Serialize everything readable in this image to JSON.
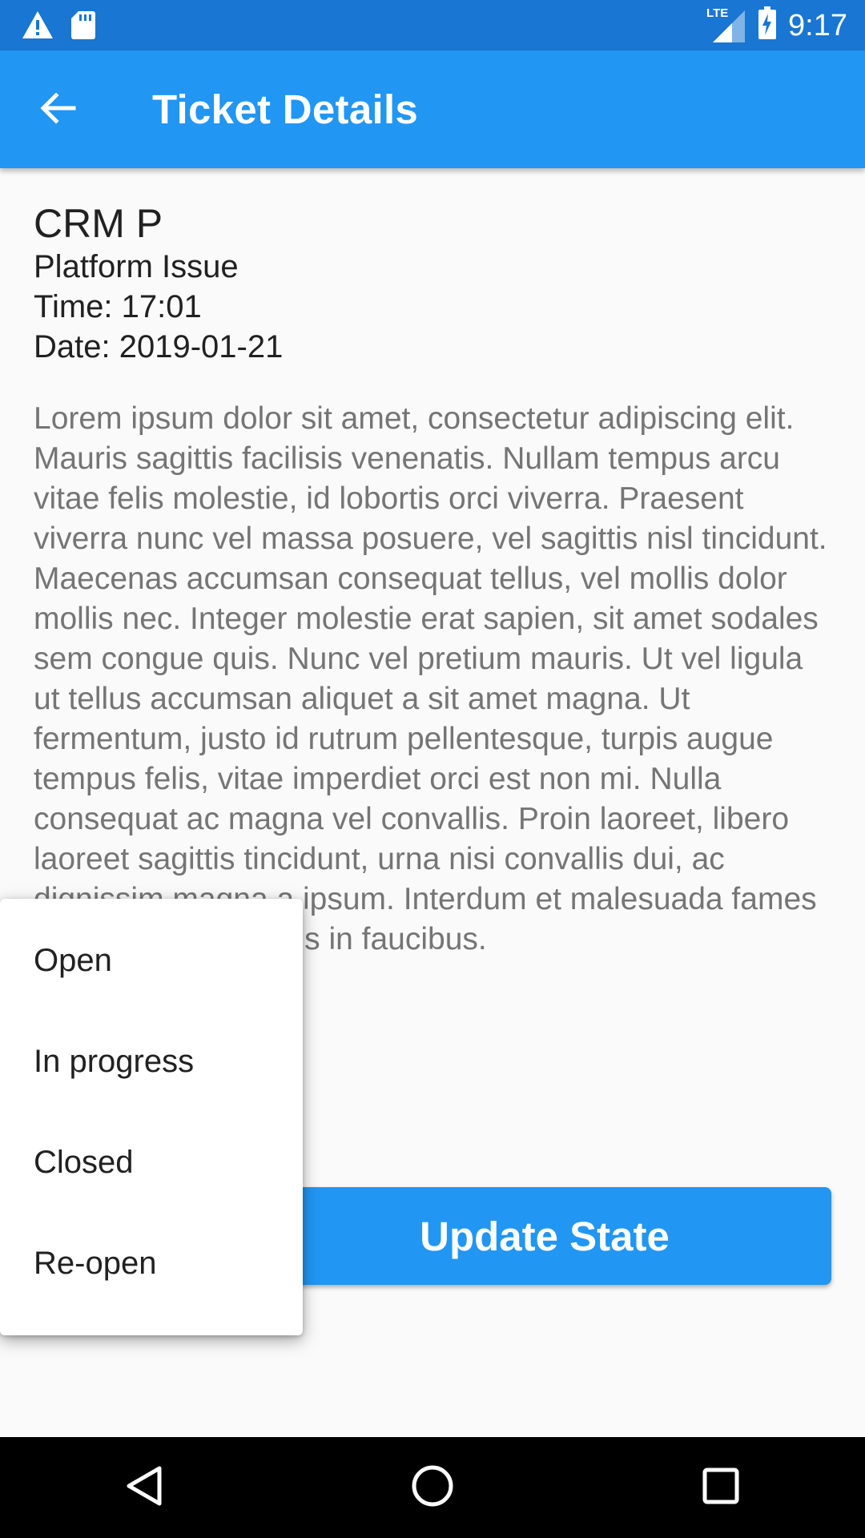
{
  "status_bar": {
    "time": "9:17",
    "network_label": "LTE",
    "icons": [
      "warning-icon",
      "sd-card-icon",
      "lte-signal-icon",
      "battery-charging-icon"
    ]
  },
  "app_bar": {
    "title": "Ticket Details",
    "back_icon": "arrow-back-icon"
  },
  "ticket": {
    "title": "CRM P",
    "category": "Platform Issue",
    "time": "Time: 17:01",
    "date": "Date: 2019-01-21",
    "description": "Lorem ipsum dolor sit amet, consectetur adipiscing elit. Mauris sagittis facilisis venenatis. Nullam tempus arcu vitae felis molestie, id lobortis orci viverra. Praesent viverra nunc vel massa posuere, vel sagittis nisl tincidunt. Maecenas accumsan consequat tellus, vel mollis dolor mollis nec. Integer molestie erat sapien, sit amet sodales sem congue quis. Nunc vel pretium mauris. Ut vel ligula ut tellus accumsan aliquet a sit amet magna. Ut fermentum, justo id rutrum pellentesque, turpis augue tempus felis, vitae imperdiet orci est non mi. Nulla consequat ac magna vel convallis. Proin laoreet, libero laoreet sagittis tincidunt, urna nisi convallis dui, ac dignissim magna a ipsum. Interdum et malesuada fames ac ante ipsum primis in faucibus."
  },
  "actions": {
    "update_label": "Update State"
  },
  "state_menu": {
    "items": [
      {
        "label": "Open"
      },
      {
        "label": "In progress"
      },
      {
        "label": "Closed"
      },
      {
        "label": "Re-open"
      }
    ]
  },
  "nav_bar": {
    "icons": [
      "back-triangle-icon",
      "home-circle-icon",
      "recents-square-icon"
    ]
  },
  "colors": {
    "status_bar": "#1976d2",
    "app_bar": "#2196f3",
    "button": "#2196f3",
    "background": "#fafafa",
    "description_text": "#757575"
  }
}
